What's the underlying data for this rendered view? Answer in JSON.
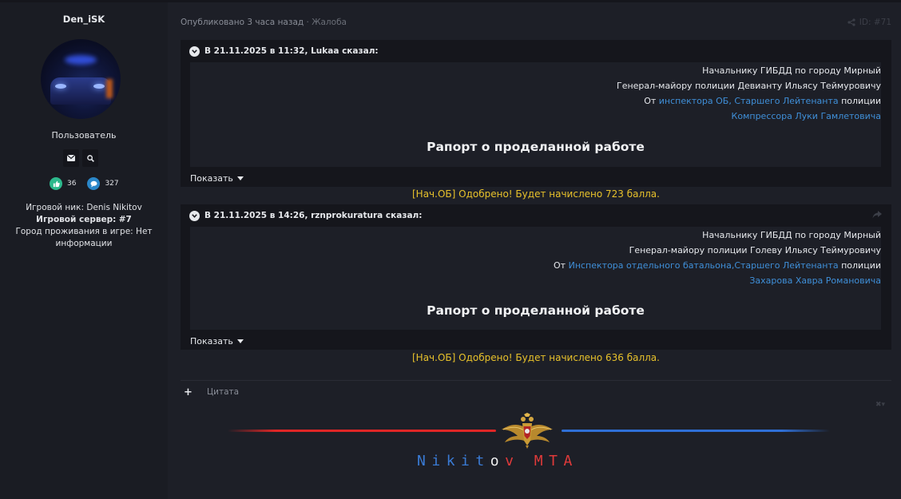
{
  "sidebar": {
    "username": "Den_iSK",
    "role": "Пользователь",
    "likes": "36",
    "messages": "327",
    "game_nick_label": "Игровой ник:",
    "game_nick": "Denis Nikitov",
    "server_label": "Игровой сервер:",
    "server": "#7",
    "city_label": "Город проживания в игре:",
    "city": "Нет информации"
  },
  "post": {
    "meta": "Опубликовано 3 часа назад",
    "separator": "·",
    "report": "Жалоба",
    "id": "ID: #71"
  },
  "quotes": [
    {
      "header": "В 21.11.2025 в 11:32, Lukaa сказал:",
      "line1": "Начальнику ГИБДД по городу Мирный",
      "line2": "Генерал-майору полиции Девианту Ильясу Теймуровичу",
      "line3_prefix": "От",
      "line3_link": "инспектора ОБ, Старшего Лейтенанта",
      "line3_suffix": "полиции",
      "line4": "Компрессора Луки Гамлетовича",
      "title": "Рапорт о проделанной работе",
      "show_more": "Показать",
      "verdict": "[Нач.ОБ] Одобрено! Будет начислено 723 балла."
    },
    {
      "header": "В 21.11.2025 в 14:26, rznprokuratura сказал:",
      "line1": "Начальнику ГИБДД по городу Мирный",
      "line2": "Генерал-майору полиции Голеву Ильясу Теймуровичу",
      "line3_prefix": "От",
      "line3_link": "Инспектора отдельного батальона,Старшего Лейтенанта",
      "line3_suffix": "полиции",
      "line4": "Захарова Хавра Романовича",
      "title": "Рапорт о проделанной работе",
      "show_more": "Показать",
      "verdict": "[Нач.ОБ] Одобрено! Будет начислено 636 балла."
    }
  ],
  "actions": {
    "quote_label": "Цитата"
  },
  "signature": {
    "letters": [
      "N",
      "i",
      "k",
      "i",
      "t",
      "o",
      "v",
      " ",
      "M",
      "T",
      "A"
    ],
    "letter_colors": [
      "#3a7bd5",
      "#3a7bd5",
      "#3a7bd5",
      "#3a7bd5",
      "#3a7bd5",
      "#f2f2f2",
      "#e03a3a",
      "",
      "#e03a3a",
      "#e03a3a",
      "#e03a3a"
    ]
  },
  "colors": {
    "link": "#3f8fd8",
    "approved": "#e7c12b",
    "background": "#1d1f27",
    "quote_bg": "#15161c"
  }
}
